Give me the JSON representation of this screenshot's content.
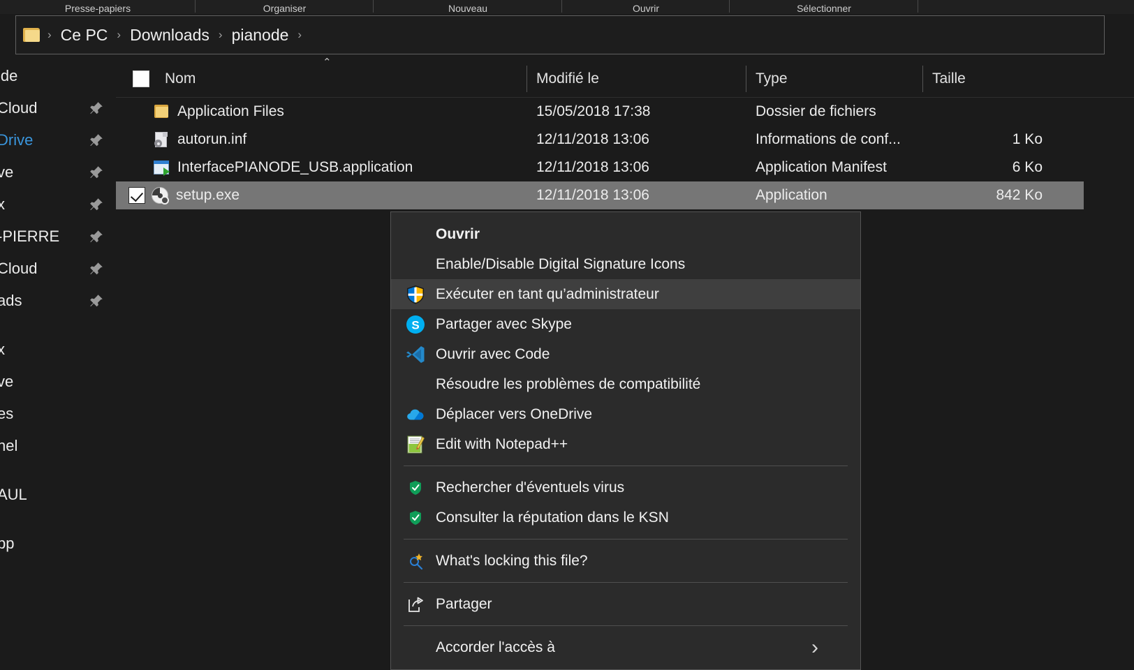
{
  "ribbon": {
    "groups": [
      "Presse-papiers",
      "Organiser",
      "Nouveau",
      "Ouvrir",
      "Sélectionner"
    ]
  },
  "addressbar": {
    "folder_icon": "folder-icon",
    "crumbs": [
      "Ce PC",
      "Downloads",
      "pianode"
    ],
    "chevron": "›"
  },
  "navpane": {
    "items": [
      {
        "label": "ide",
        "pinned": false,
        "accent": "normal"
      },
      {
        "label": "Cloud",
        "pinned": true,
        "accent": "normal"
      },
      {
        "label": "Drive",
        "pinned": true,
        "accent": "blue"
      },
      {
        "label": "ve",
        "pinned": true,
        "accent": "normal"
      },
      {
        "label": "x",
        "pinned": true,
        "accent": "normal"
      },
      {
        "label": "-PIERRE",
        "pinned": true,
        "accent": "normal"
      },
      {
        "label": "Cloud",
        "pinned": true,
        "accent": "normal"
      },
      {
        "label": "ads",
        "pinned": true,
        "accent": "normal"
      },
      {
        "label": "x",
        "pinned": false,
        "accent": "normal"
      },
      {
        "label": "ve",
        "pinned": false,
        "accent": "normal"
      },
      {
        "label": "es",
        "pinned": false,
        "accent": "normal"
      },
      {
        "label": "nel",
        "pinned": false,
        "accent": "normal"
      },
      {
        "label": "AUL",
        "pinned": false,
        "accent": "normal"
      },
      {
        "label": "pp",
        "pinned": false,
        "accent": "normal"
      }
    ]
  },
  "filelist": {
    "columns": {
      "name": "Nom",
      "modified": "Modifié le",
      "type": "Type",
      "size": "Taille"
    },
    "sort_caret": "⌃",
    "rows": [
      {
        "icon": "folder-icon",
        "name": "Application Files",
        "modified": "15/05/2018 17:38",
        "type": "Dossier de fichiers",
        "size": "",
        "selected": false,
        "checked": false
      },
      {
        "icon": "inf-file-icon",
        "name": "autorun.inf",
        "modified": "12/11/2018 13:06",
        "type": "Informations de conf...",
        "size": "1 Ko",
        "selected": false,
        "checked": false
      },
      {
        "icon": "application-manifest-icon",
        "name": "InterfacePIANODE_USB.application",
        "modified": "12/11/2018 13:06",
        "type": "Application Manifest",
        "size": "6 Ko",
        "selected": false,
        "checked": false
      },
      {
        "icon": "setup-disc-icon",
        "name": "setup.exe",
        "modified": "12/11/2018 13:06",
        "type": "Application",
        "size": "842 Ko",
        "selected": true,
        "checked": true
      }
    ]
  },
  "contextmenu": {
    "items": [
      {
        "kind": "item",
        "label": "Ouvrir",
        "icon": "",
        "bold": true,
        "highlighted": false,
        "submenu": false
      },
      {
        "kind": "item",
        "label": "Enable/Disable Digital Signature Icons",
        "icon": "",
        "bold": false,
        "highlighted": false,
        "submenu": false
      },
      {
        "kind": "item",
        "label": "Exécuter en tant qu’administrateur",
        "icon": "uac-shield-icon",
        "bold": false,
        "highlighted": true,
        "submenu": false
      },
      {
        "kind": "item",
        "label": "Partager avec Skype",
        "icon": "skype-icon",
        "bold": false,
        "highlighted": false,
        "submenu": false
      },
      {
        "kind": "item",
        "label": "Ouvrir avec Code",
        "icon": "vscode-icon",
        "bold": false,
        "highlighted": false,
        "submenu": false
      },
      {
        "kind": "item",
        "label": "Résoudre les problèmes de compatibilité",
        "icon": "",
        "bold": false,
        "highlighted": false,
        "submenu": false
      },
      {
        "kind": "item",
        "label": "Déplacer vers OneDrive",
        "icon": "onedrive-icon",
        "bold": false,
        "highlighted": false,
        "submenu": false
      },
      {
        "kind": "item",
        "label": "Edit with Notepad++",
        "icon": "notepadpp-icon",
        "bold": false,
        "highlighted": false,
        "submenu": false
      },
      {
        "kind": "separator"
      },
      {
        "kind": "item",
        "label": "Rechercher d'éventuels virus",
        "icon": "kaspersky-shield-icon",
        "bold": false,
        "highlighted": false,
        "submenu": false
      },
      {
        "kind": "item",
        "label": "Consulter la réputation dans le KSN",
        "icon": "kaspersky-shield-icon",
        "bold": false,
        "highlighted": false,
        "submenu": false
      },
      {
        "kind": "separator"
      },
      {
        "kind": "item",
        "label": "What's locking this file?",
        "icon": "lock-hunter-icon",
        "bold": false,
        "highlighted": false,
        "submenu": false
      },
      {
        "kind": "separator"
      },
      {
        "kind": "item",
        "label": "Partager",
        "icon": "share-icon",
        "bold": false,
        "highlighted": false,
        "submenu": false
      },
      {
        "kind": "separator"
      },
      {
        "kind": "item",
        "label": "Accorder l'accès à",
        "icon": "",
        "bold": false,
        "highlighted": false,
        "submenu": true
      }
    ],
    "submenu_chevron": "›"
  },
  "colors": {
    "window_bg": "#1b1b1b",
    "menu_bg": "#2b2b2b",
    "menu_highlight": "#3f3f3f",
    "row_selected": "#767676",
    "accent_blue": "#3a96dd",
    "folder_yellow": "#e0b14b"
  }
}
